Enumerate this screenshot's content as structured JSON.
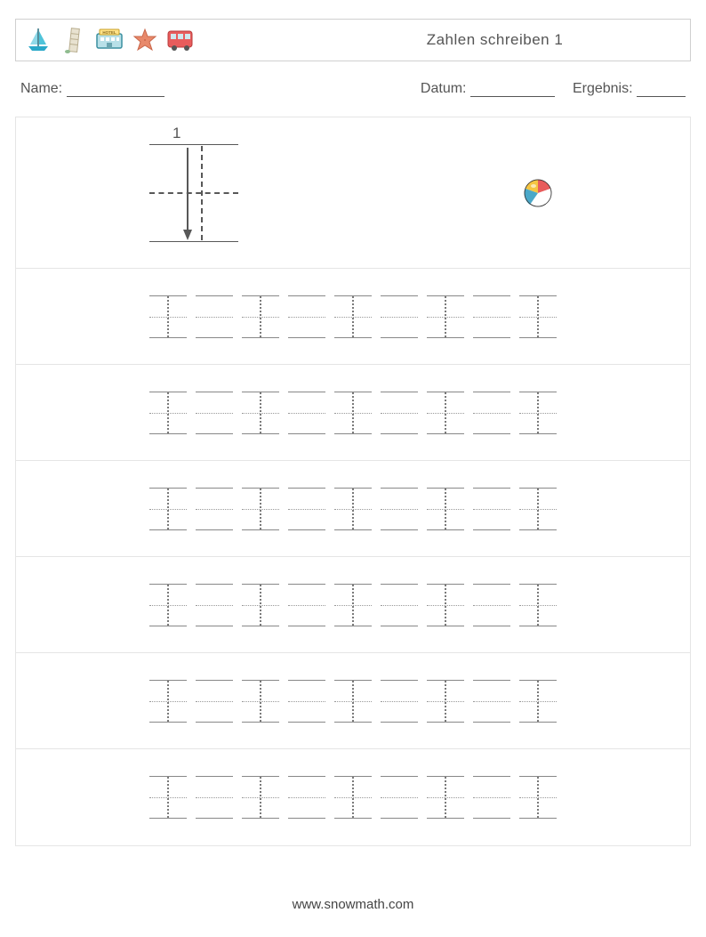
{
  "header": {
    "title": "Zahlen schreiben 1",
    "icons": [
      "sailboat-icon",
      "leaning-tower-icon",
      "hotel-icon",
      "starfish-icon",
      "bus-icon"
    ]
  },
  "info": {
    "name_label": "Name:",
    "date_label": "Datum:",
    "result_label": "Ergebnis:"
  },
  "demo": {
    "number": "1",
    "stroke_label": "1",
    "image_name": "beach-ball"
  },
  "practice": {
    "rows": 6,
    "digit_cells_per_row": 5,
    "blank_cells_between": 1,
    "trace_character": "1"
  },
  "footer": {
    "url": "www.snowmath.com"
  }
}
